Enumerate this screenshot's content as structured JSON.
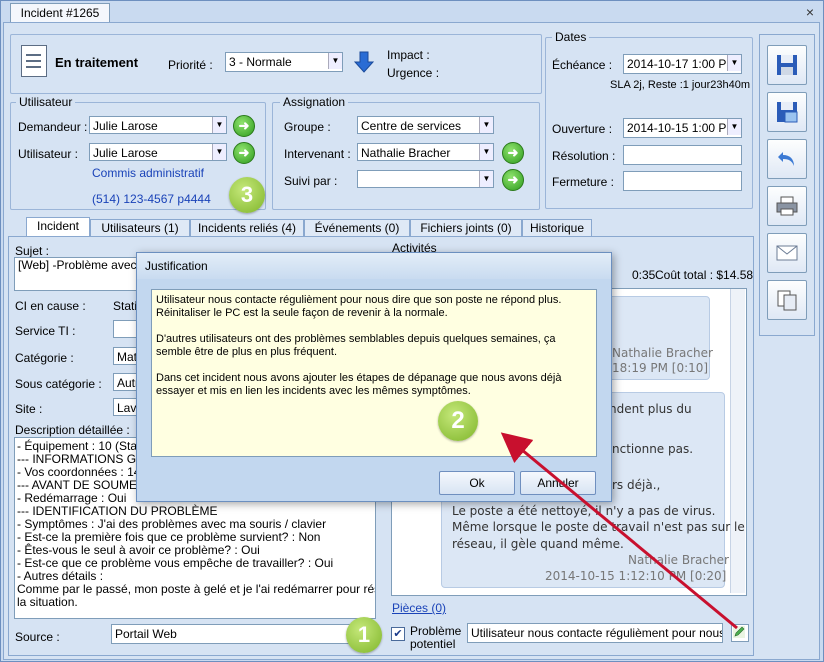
{
  "window": {
    "doc_tab": "Incident #1265",
    "close": "×"
  },
  "header": {
    "status": "En traitement",
    "priority_label": "Priorité :",
    "priority_value": "3 - Normale",
    "impact_label": "Impact :",
    "urgence_label": "Urgence :"
  },
  "utilisateur": {
    "title": "Utilisateur",
    "demandeur_label": "Demandeur :",
    "demandeur_value": "Julie Larose",
    "utilisateur_label": "Utilisateur :",
    "utilisateur_value": "Julie Larose",
    "role": "Commis administratif",
    "phone": "(514) 123-4567 p4444"
  },
  "assignation": {
    "title": "Assignation",
    "groupe_label": "Groupe :",
    "groupe_value": "Centre de services",
    "intervenant_label": "Intervenant :",
    "intervenant_value": "Nathalie Bracher",
    "suivi_label": "Suivi par :",
    "suivi_value": ""
  },
  "dates": {
    "title": "Dates",
    "echeance_label": "Échéance :",
    "echeance_value": "2014-10-17  1:00 PM",
    "sla": "SLA 2j, Reste :1 jour23h40m",
    "ouverture_label": "Ouverture :",
    "ouverture_value": "2014-10-15  1:00 PM",
    "resolution_label": "Résolution :",
    "fermeture_label": "Fermeture :"
  },
  "tabs": [
    "Incident",
    "Utilisateurs (1)",
    "Incidents reliés (4)",
    "Événements (0)",
    "Fichiers joints (0)",
    "Historique"
  ],
  "incident": {
    "sujet_label": "Sujet :",
    "sujet_value": "[Web] -Problème avec m",
    "ci_label": "CI en cause :",
    "ci_value": "Stati",
    "service_label": "Service TI :",
    "categorie_label": "Catégorie :",
    "categorie_value": "Mat",
    "souscat_label": "Sous catégorie :",
    "souscat_value": "Autr",
    "site_label": "Site :",
    "site_value": "Lava",
    "desc_label": "Description détaillée :",
    "desc_text": "- Équipement : 10 (Station\n--- INFORMATIONS GÉN\n- Vos coordonnées : 1478\n--- AVANT DE SOUMETT\n- Redémarrage : Oui\n--- IDENTIFICATION DU PROBLÈME\n- Symptômes : J'ai des problèmes avec ma souris / clavier\n- Est-ce la première fois que ce problème survient? : Non\n- Êtes-vous le seul à avoir ce problème? : Oui\n- Est-ce que ce problème vous empêche de travailler? : Oui\n- Autres détails :\nComme par le passé, mon poste à gelé et je l'ai redémarrer pour résoudre\nla situation.",
    "source_label": "Source :",
    "source_value": "Portail Web"
  },
  "activites": {
    "label": "Activités",
    "time": "0:35",
    "cout": "Coût total : $14.58",
    "msg1_author": "Nathalie Bracher",
    "msg1_time": "18:19 PM [0:10]",
    "msg2_lines": [
      "ndent plus du",
      "nctionne pas.",
      "rs déjà.,",
      "Le poste a été nettoyé, il n'y a pas de virus.",
      "Même lorsque le poste de travail n'est pas sur le",
      "réseau, il gèle quand même."
    ],
    "msg2_author": "Nathalie Bracher",
    "msg2_time": "2014-10-15 1:12:10 PM [0:20]",
    "pieces": "Pièces (0)"
  },
  "probleme": {
    "label_line1": "Problème",
    "label_line2": "potentiel",
    "justif_value": "Utilisateur nous contacte régulièment pour nous dire"
  },
  "dialog": {
    "title": "Justification",
    "p1": "Utilisateur nous contacte régulièment pour nous dire que son poste ne répond plus. Réinitaliser le PC est la seule façon de revenir à la normale.",
    "p2": "D'autres utilisateurs ont des problèmes semblables depuis quelques semaines, ça semble être de plus en plus fréquent.",
    "p3": "Dans cet incident nous avons ajouter les étapes de dépanage que nous avons déjà essayer et mis en lien les incidents avec les mêmes symptômes.",
    "ok": "Ok",
    "cancel": "Annuler"
  },
  "badges": {
    "one": "1",
    "two": "2",
    "three": "3"
  },
  "colors": {
    "accent": "#1a43b8",
    "badge_green": "#7fb52a",
    "arrow_red": "#c8102e"
  }
}
